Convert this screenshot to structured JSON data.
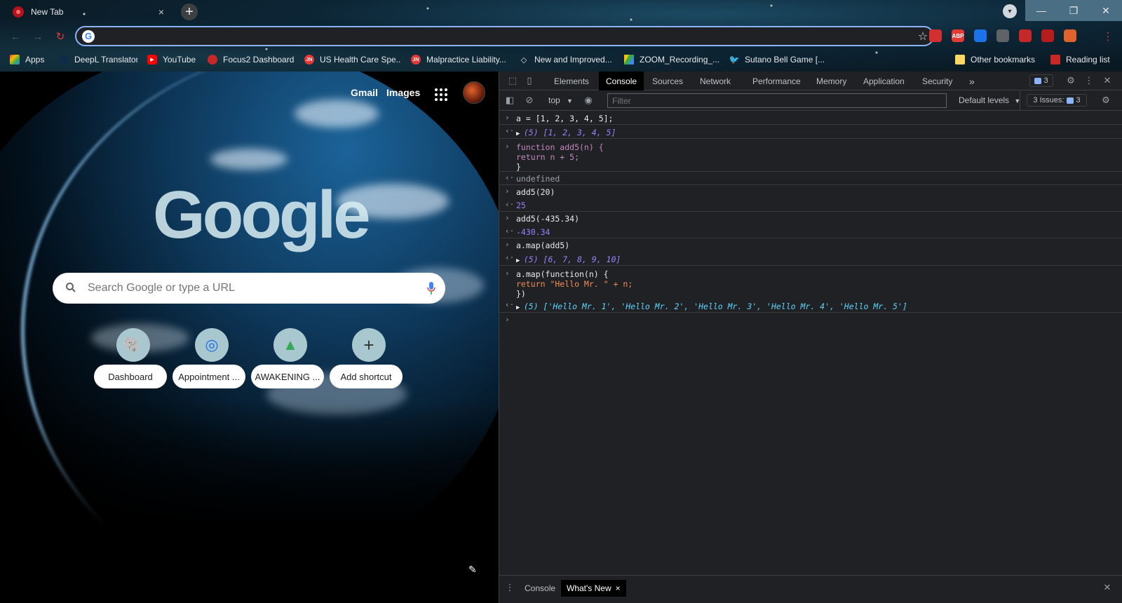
{
  "browser": {
    "tab_title": "New Tab",
    "tab_close": "×",
    "new_tab": "+",
    "window_controls": {
      "minimize": "—",
      "restore": "❐",
      "close": "✕"
    },
    "omnibox": {
      "value": "",
      "placeholder": ""
    },
    "bookmarks": [
      {
        "label": "Apps",
        "color": "#ea4335"
      },
      {
        "label": "DeepL Translator",
        "color": "#0f2b46"
      },
      {
        "label": "YouTube",
        "color": "#ff0000"
      },
      {
        "label": "Focus2 Dashboard",
        "color": "#c62828"
      },
      {
        "label": "US Health Care Spe...",
        "color": "#e53935"
      },
      {
        "label": "Malpractice Liability...",
        "color": "#e53935"
      },
      {
        "label": "New and Improved...",
        "color": "#9e9e9e"
      },
      {
        "label": "ZOOM_Recording_...",
        "color": "#fbbc04"
      },
      {
        "label": "Sutano Bell Game [...",
        "color": "#1da1f2"
      }
    ],
    "other_bookmarks": "Other bookmarks",
    "reading_list": "Reading list",
    "extensions": [
      {
        "name": "red-extension-icon",
        "text": "",
        "color": "#d32f2f"
      },
      {
        "name": "adblock-plus-icon",
        "text": "ABP",
        "color": "#e53935"
      },
      {
        "name": "search-extension-icon",
        "text": "",
        "color": "#1a73e8"
      },
      {
        "name": "gear-extension-icon",
        "text": "",
        "color": "#5f6368"
      },
      {
        "name": "puzzle-extension-icon",
        "text": "",
        "color": "#c62828"
      },
      {
        "name": "red-tool-extension-icon",
        "text": "",
        "color": "#b71c1c"
      },
      {
        "name": "profile-extension-icon",
        "text": "",
        "color": "#e0632e"
      }
    ]
  },
  "ntp": {
    "gmail": "Gmail",
    "images": "Images",
    "logo": "Google",
    "search_placeholder": "Search Google or type a URL",
    "shortcuts": [
      {
        "label": "Dashboard",
        "icon": "🐘"
      },
      {
        "label": "Appointment ...",
        "icon": "◎"
      },
      {
        "label": "AWAKENING ...",
        "icon": "▲"
      },
      {
        "label": "Add shortcut",
        "icon": "+"
      }
    ]
  },
  "devtools": {
    "tabs": [
      "Elements",
      "Console",
      "Sources",
      "Network",
      "Performance",
      "Memory",
      "Application",
      "Security"
    ],
    "active_tab": "Console",
    "more_tabs": "»",
    "messages_count": "3",
    "context": "top",
    "filter_placeholder": "Filter",
    "default_levels": "Default levels",
    "issues_label": "3 Issues:",
    "issues_count": "3",
    "drawer_tabs": [
      "Console",
      "What's New"
    ],
    "drawer_active": "What's New",
    "drawer_close": "×"
  },
  "console_lines": {
    "l1_in": "a = [1, 2, 3, 4, 5];",
    "l1_out": "(5) [1, 2, 3, 4, 5]",
    "l2_in_1": "function add5(n) {",
    "l2_in_2": "return n + 5;",
    "l2_in_3": "}",
    "l2_out": "undefined",
    "l3_in": "add5(20)",
    "l3_out": "25",
    "l4_in": "add5(-435.34)",
    "l4_out": "-430.34",
    "l5_in": "a.map(add5)",
    "l5_out": "(5) [6, 7, 8, 9, 10]",
    "l6_in_1": "a.map(function(n) {",
    "l6_in_2": "return \"Hello Mr. \" + n;",
    "l6_in_3": "})",
    "l6_out": "(5) ['Hello Mr. 1', 'Hello Mr. 2', 'Hello Mr. 3', 'Hello Mr. 4', 'Hello Mr. 5']"
  },
  "colors": {
    "accent": "#8ab4f8",
    "devtools_bg": "#202124",
    "console_number": "#9980ff",
    "console_string": "#5cd5fb"
  }
}
